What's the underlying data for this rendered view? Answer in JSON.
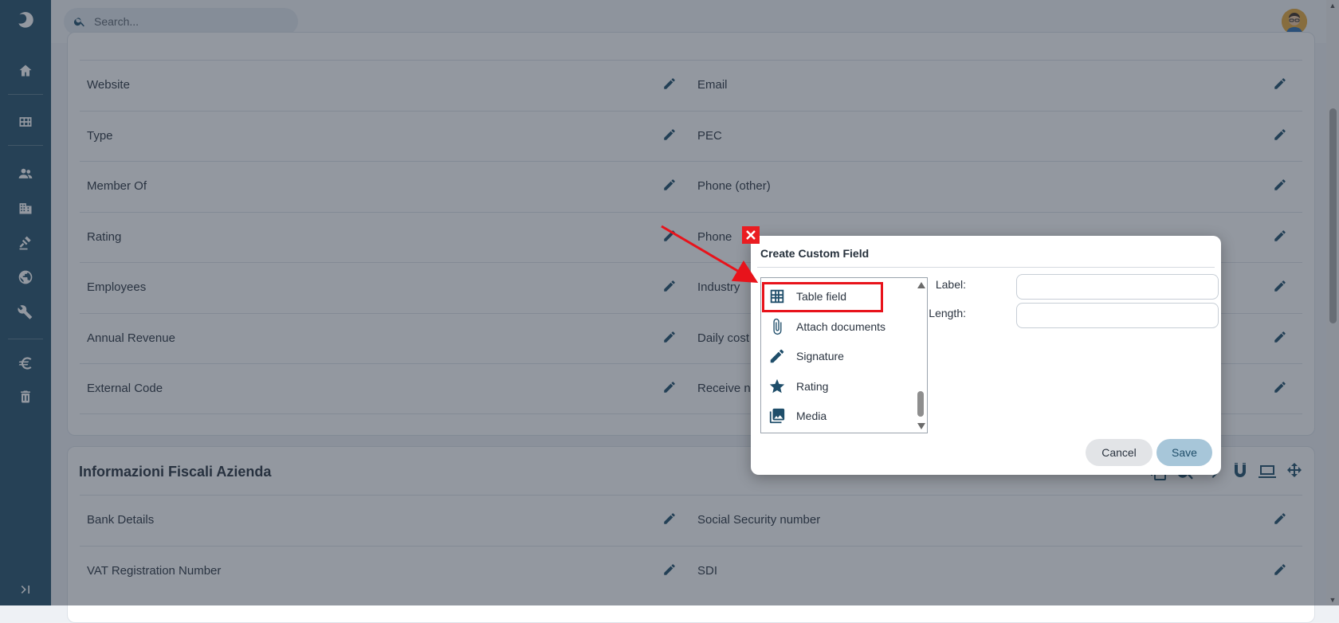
{
  "search": {
    "placeholder": "Search..."
  },
  "rows": [
    {
      "left": "Website",
      "right": "Email"
    },
    {
      "left": "Type",
      "right": "PEC"
    },
    {
      "left": "Member Of",
      "right": "Phone (other)"
    },
    {
      "left": "Rating",
      "right": "Phone"
    },
    {
      "left": "Employees",
      "right": "Industry"
    },
    {
      "left": "Annual Revenue",
      "right": "Daily cost"
    },
    {
      "left": "External Code",
      "right": "Receive ne"
    }
  ],
  "fiscal_section": {
    "title": "Informazioni Fiscali Azienda",
    "rows": [
      {
        "left": "Bank Details",
        "right": "Social Security number"
      },
      {
        "left": "VAT Registration Number",
        "right": "SDI"
      }
    ]
  },
  "dialog": {
    "title": "Create Custom Field",
    "field_types": [
      {
        "label": "Table field",
        "icon": "table-icon"
      },
      {
        "label": "Attach documents",
        "icon": "paperclip-icon"
      },
      {
        "label": "Signature",
        "icon": "pencil-icon"
      },
      {
        "label": "Rating",
        "icon": "star-icon"
      },
      {
        "label": "Media",
        "icon": "photo-library-icon"
      }
    ],
    "label_caption": "Label:",
    "length_caption": "Length:",
    "label_value": "",
    "length_value": "",
    "cancel_label": "Cancel",
    "save_label": "Save"
  },
  "annotation": {
    "highlight_color": "#e8131b",
    "highlighted_item": "Table field"
  },
  "colors": {
    "sidebar": "#24506a",
    "accent": "#1f4e6a",
    "save_button": "#a7c6d9"
  }
}
